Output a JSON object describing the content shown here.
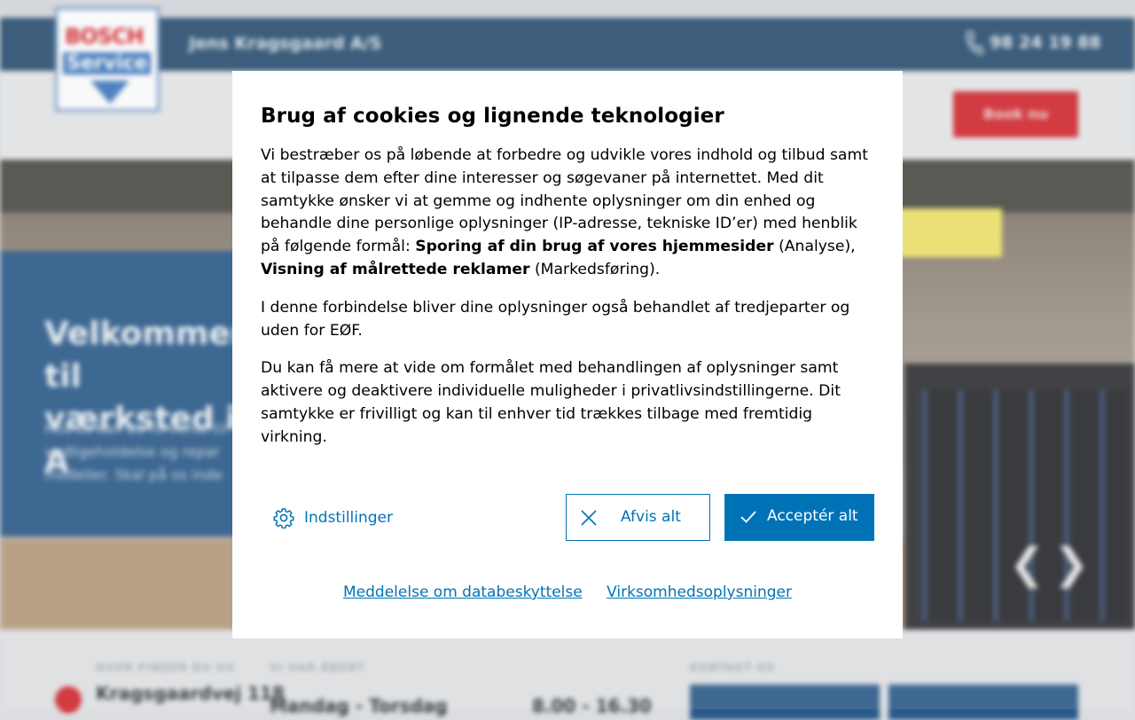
{
  "background": {
    "address": "Jens Kragsgaard A/S",
    "phone": "98 24 19 88",
    "logo": {
      "line1": "BOSCH",
      "line2": "Service"
    },
    "book_button": "Book nu",
    "hero_title": "Velkommen til\nværksted i A",
    "hero_text": "Hos os kan du forvente til vedligeholdelse og repar modeller. Skal på os inde",
    "info": {
      "find_label": "HVOR FINDER DU OS",
      "find_value": "Kragsgaardvej 118",
      "open_label": "VI HAR ÅBENT",
      "open_days": "Mandag - Torsdag",
      "open_hours": "8.00 - 16.30",
      "contact_label": "KONTAKT OS"
    }
  },
  "dialog": {
    "title": "Brug af cookies og lignende teknologier",
    "p1_text": "Vi bestræber os på løbende at forbedre og udvikle vores indhold og tilbud samt at tilpasse dem efter dine interesser og søgevaner på internettet. Med dit samtykke ønsker vi at gemme og indhente oplysninger om din enhed og behandle dine personlige oplysninger (IP-adresse, tekniske ID’er) med henblik på følgende formål: ",
    "p1_bold1": "Sporing af din brug af vores hjemmesider",
    "p1_mid": " (Analyse), ",
    "p1_bold2": "Visning af målrettede reklamer",
    "p1_end": " (Markedsføring).",
    "p2": "I denne forbindelse bliver dine oplysninger også behandlet af tredjeparter og uden for EØF.",
    "p3": "Du kan få mere at vide om formålet med behandlingen af oplysninger samt aktivere og deaktivere individuelle muligheder i privatlivsindstillingerne. Dit samtykke er frivilligt og kan til enhver tid trækkes tilbage med fremtidig virkning.",
    "settings_label": "Indstillinger",
    "reject_label": "Afvis alt",
    "accept_label": "Acceptér alt",
    "link_privacy": "Meddelelse om databeskyttelse",
    "link_company": "Virksomhedsoplysninger",
    "accent_color": "#0073b7"
  }
}
